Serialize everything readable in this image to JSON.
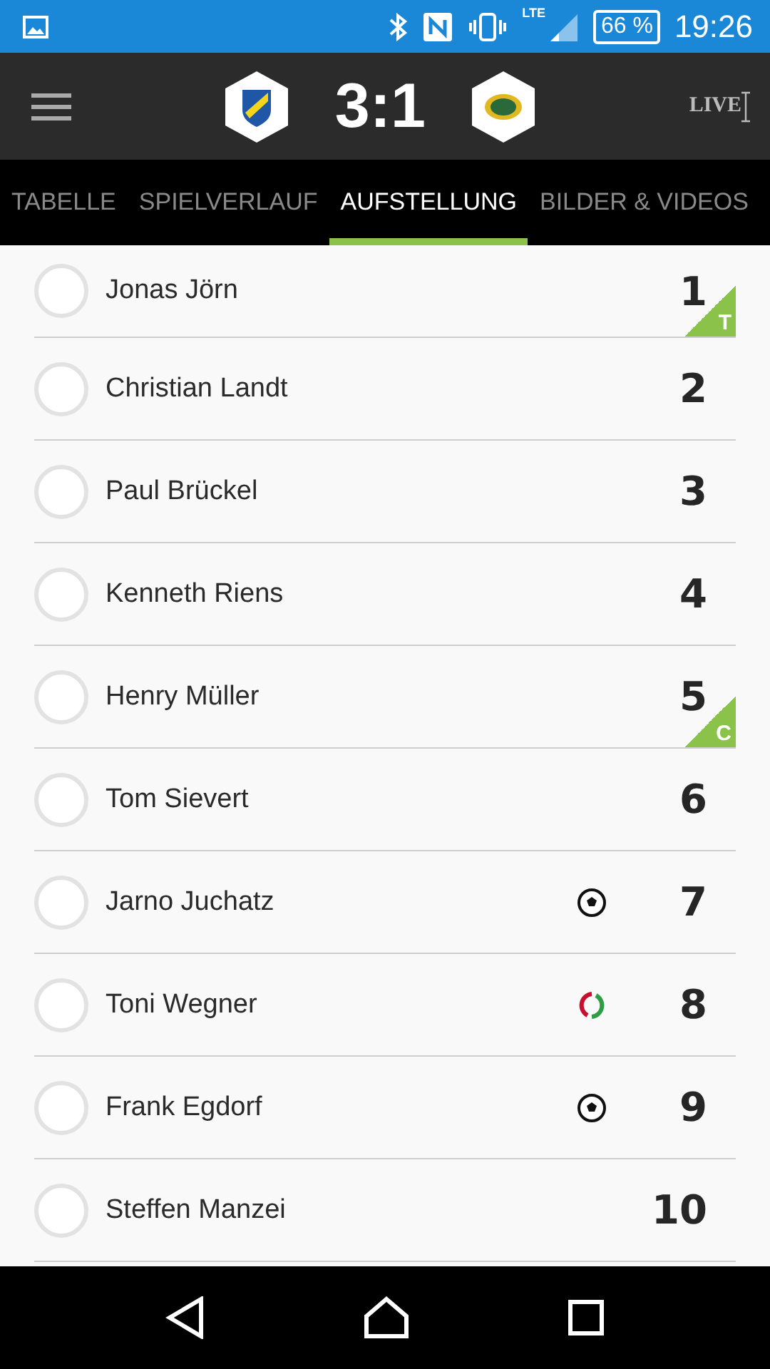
{
  "status_bar": {
    "battery": "66 %",
    "time": "19:26",
    "network": "LTE"
  },
  "header": {
    "score": "3:1",
    "live": "LIVE"
  },
  "tabs": [
    {
      "label": "TABELLE",
      "selected": false
    },
    {
      "label": "SPIELVERLAUF",
      "selected": false
    },
    {
      "label": "AUFSTELLUNG",
      "selected": true
    },
    {
      "label": "BILDER & VIDEOS",
      "selected": false
    }
  ],
  "players": [
    {
      "name": "Jonas Jörn",
      "number": "1",
      "badge": "T",
      "kind": "plain"
    },
    {
      "name": "Christian Landt",
      "number": "2",
      "kind": "plain"
    },
    {
      "name": "Paul Brückel",
      "number": "3",
      "kind": "plain"
    },
    {
      "name": "Kenneth Riens",
      "number": "4",
      "kind": "plain"
    },
    {
      "name": "Henry Müller",
      "number": "5",
      "badge": "C",
      "kind": "plain"
    },
    {
      "name": "Tom Sievert",
      "number": "6",
      "kind": "plain"
    },
    {
      "name": "Jarno Juchatz",
      "number": "7",
      "kind": "goal"
    },
    {
      "name": "Toni Wegner",
      "number": "8",
      "kind": "substitution"
    },
    {
      "name": "Frank Egdorf",
      "number": "9",
      "kind": "goal"
    },
    {
      "name": "Steffen Manzei",
      "number": "10",
      "kind": "plain"
    }
  ]
}
